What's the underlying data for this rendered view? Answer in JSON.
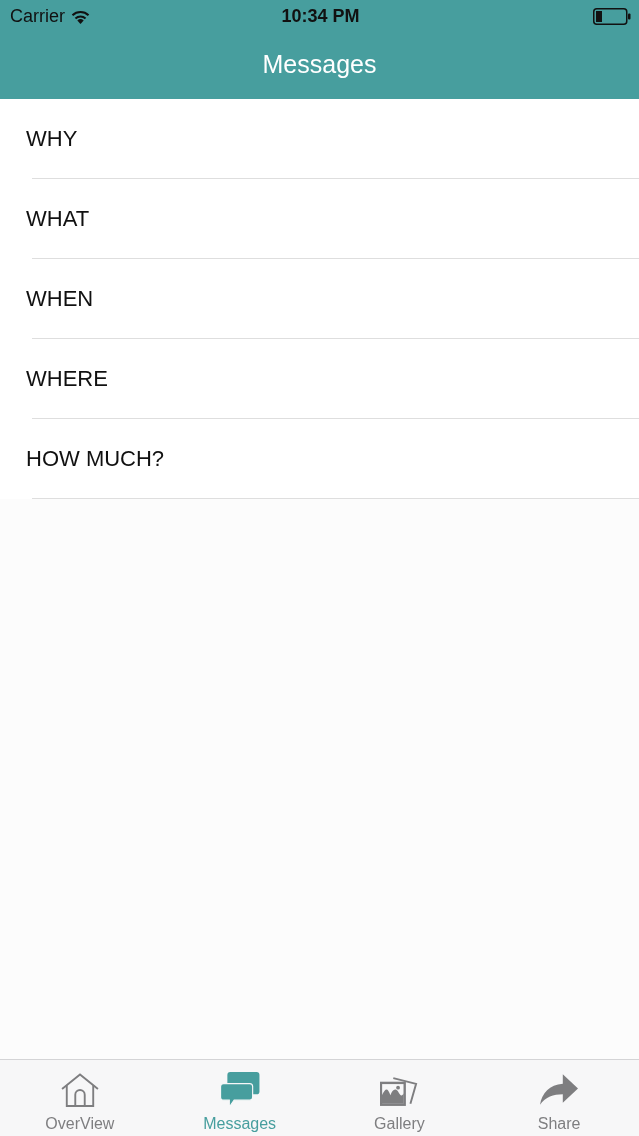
{
  "status_bar": {
    "carrier": "Carrier",
    "time": "10:34 PM"
  },
  "nav_bar": {
    "title": "Messages"
  },
  "list": {
    "items": [
      {
        "label": "WHY"
      },
      {
        "label": "WHAT"
      },
      {
        "label": "WHEN"
      },
      {
        "label": "WHERE"
      },
      {
        "label": "HOW MUCH?"
      }
    ]
  },
  "tab_bar": {
    "tabs": [
      {
        "label": "OverView",
        "selected": false
      },
      {
        "label": "Messages",
        "selected": true
      },
      {
        "label": "Gallery",
        "selected": false
      },
      {
        "label": "Share",
        "selected": false
      }
    ]
  }
}
